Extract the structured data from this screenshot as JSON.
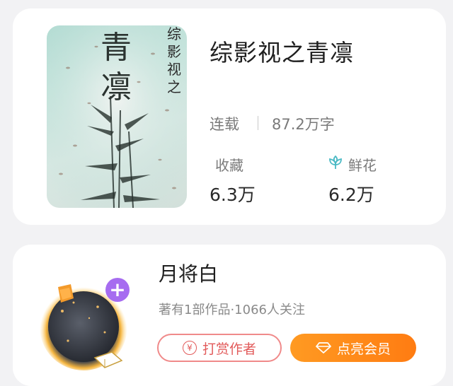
{
  "book": {
    "title": "综影视之青凛",
    "cover": {
      "title_big": "青凛",
      "title_small": "综影视之"
    },
    "status": "连载",
    "word_count": "87.2万字",
    "stats": [
      {
        "label": "收藏",
        "value": "6.3万",
        "icon": ""
      },
      {
        "label": "鲜花",
        "value": "6.2万",
        "icon": "flower-icon"
      }
    ]
  },
  "author": {
    "name": "月将白",
    "info": "著有1部作品·1066人关注",
    "avatar_badge": "+",
    "tip_button": {
      "label": "打赏作者",
      "icon": "yen-icon",
      "icon_glyph": "¥"
    },
    "vip_button": {
      "label": "点亮会员",
      "icon": "diamond-icon"
    }
  },
  "colors": {
    "accent_orange": "#ff8a1a",
    "tip_red": "#e25a5a",
    "badge_purple": "#a66cf0",
    "flower_teal": "#49b9c4"
  }
}
